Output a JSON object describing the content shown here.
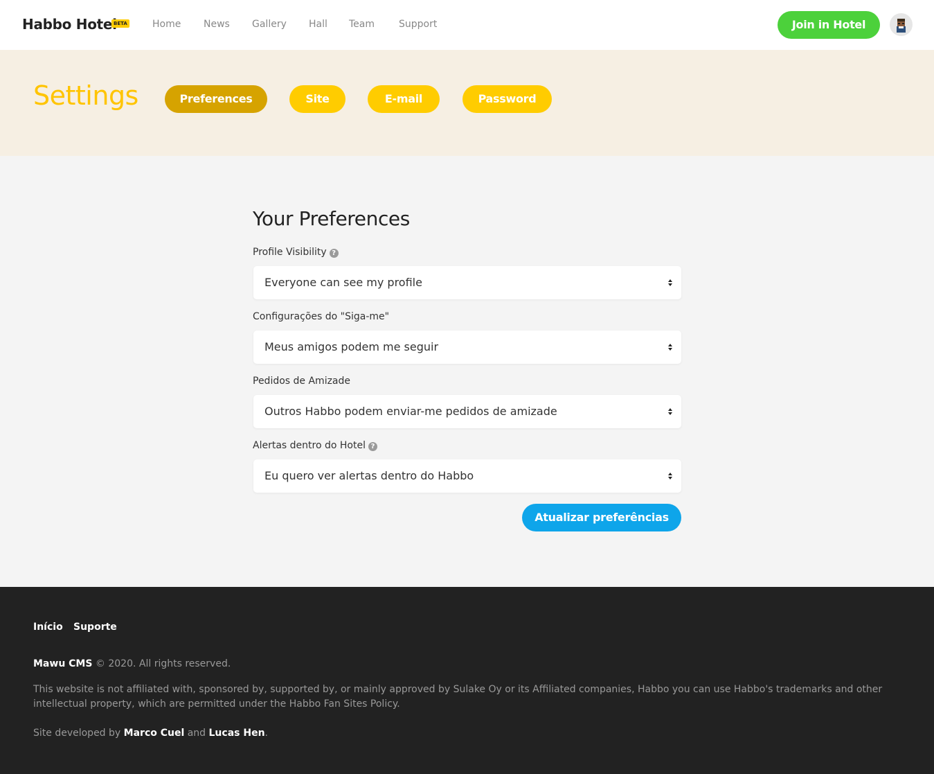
{
  "header": {
    "brand": "Habbo Hotel",
    "badge": "BETA",
    "nav": [
      "Home",
      "News",
      "Gallery",
      "Hall",
      "Team",
      "Support"
    ],
    "join_button": "Join in Hotel",
    "avatar_icon": "habbo-avatar-icon"
  },
  "hero": {
    "title": "Settings",
    "tabs": [
      {
        "label": "Preferences",
        "active": true
      },
      {
        "label": "Site",
        "active": false
      },
      {
        "label": "E-mail",
        "active": false
      },
      {
        "label": "Password",
        "active": false
      }
    ]
  },
  "form": {
    "title": "Your Preferences",
    "fields": [
      {
        "label": "Profile Visibility",
        "help": true,
        "value": "Everyone can see my profile"
      },
      {
        "label": "Configurações do \"Siga-me\"",
        "help": false,
        "value": "Meus amigos podem me seguir"
      },
      {
        "label": "Pedidos de Amizade",
        "help": false,
        "value": "Outros Habbo podem enviar-me pedidos de amizade"
      },
      {
        "label": "Alertas dentro do Hotel",
        "help": true,
        "value": "Eu quero ver alertas dentro do Habbo"
      }
    ],
    "help_glyph": "?",
    "submit": "Atualizar preferências"
  },
  "footer": {
    "links": [
      "Início",
      "Suporte"
    ],
    "copyright_brand": "Mawu CMS",
    "copyright_text": "© 2020. All rights reserved.",
    "disclaimer": "This website is not affiliated with, sponsored by, supported by, or mainly approved by Sulake Oy or its Affiliated companies, Habbo you can use Habbo's trademarks and other intellectual property, which are permitted under the Habbo Fan Sites Policy.",
    "dev_prefix": "Site developed by",
    "dev_1": "Marco Cuel",
    "dev_and": "and",
    "dev_2": "Lucas Hen",
    "dev_suffix": "."
  },
  "colors": {
    "accent_yellow": "#ffcc00",
    "active_tab": "#d6a300",
    "join_green": "#4cd13b",
    "submit_blue": "#0ea5ea",
    "hero_bg": "#f6efe3",
    "footer_bg": "#222222"
  }
}
